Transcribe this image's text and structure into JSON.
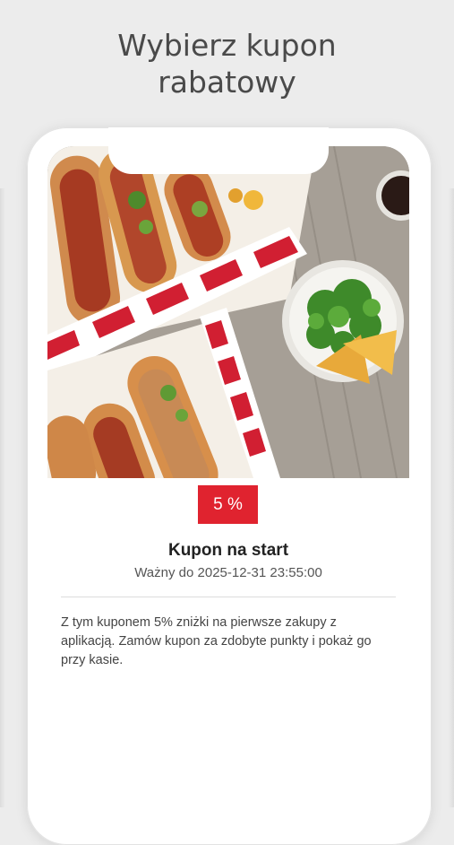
{
  "headline": {
    "line1": "Wybierz kupon",
    "line2": "rabatowy"
  },
  "coupon": {
    "discount": "5 %",
    "title": "Kupon na start",
    "validity": "Ważny do 2025-12-31 23:55:00",
    "description": "Z tym kuponem 5% zniżki na pierwsze zakupy z aplikacją. Zamów kupon za zdobyte punkty i pokaż go przy kasie."
  },
  "colors": {
    "accent": "#e0232f",
    "background": "#ececec"
  }
}
